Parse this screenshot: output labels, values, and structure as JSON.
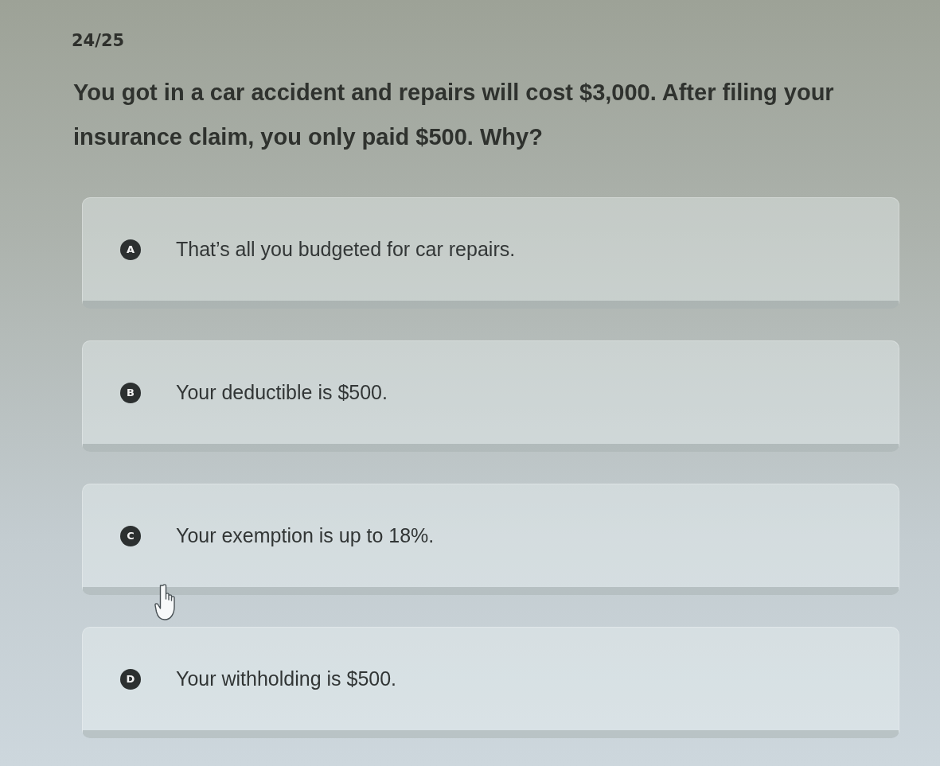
{
  "progress": "24/25",
  "question": "You got in a car accident and repairs will cost $3,000. After filing your insurance claim, you only paid $500. Why?",
  "options": [
    {
      "letter": "A",
      "text": "That’s all you budgeted for car repairs.",
      "selected": false
    },
    {
      "letter": "B",
      "text": "Your deductible is $500.",
      "selected": false
    },
    {
      "letter": "C",
      "text": "Your exemption is up to 18%.",
      "selected": false
    },
    {
      "letter": "D",
      "text": "Your withholding is $500.",
      "selected": false
    }
  ]
}
